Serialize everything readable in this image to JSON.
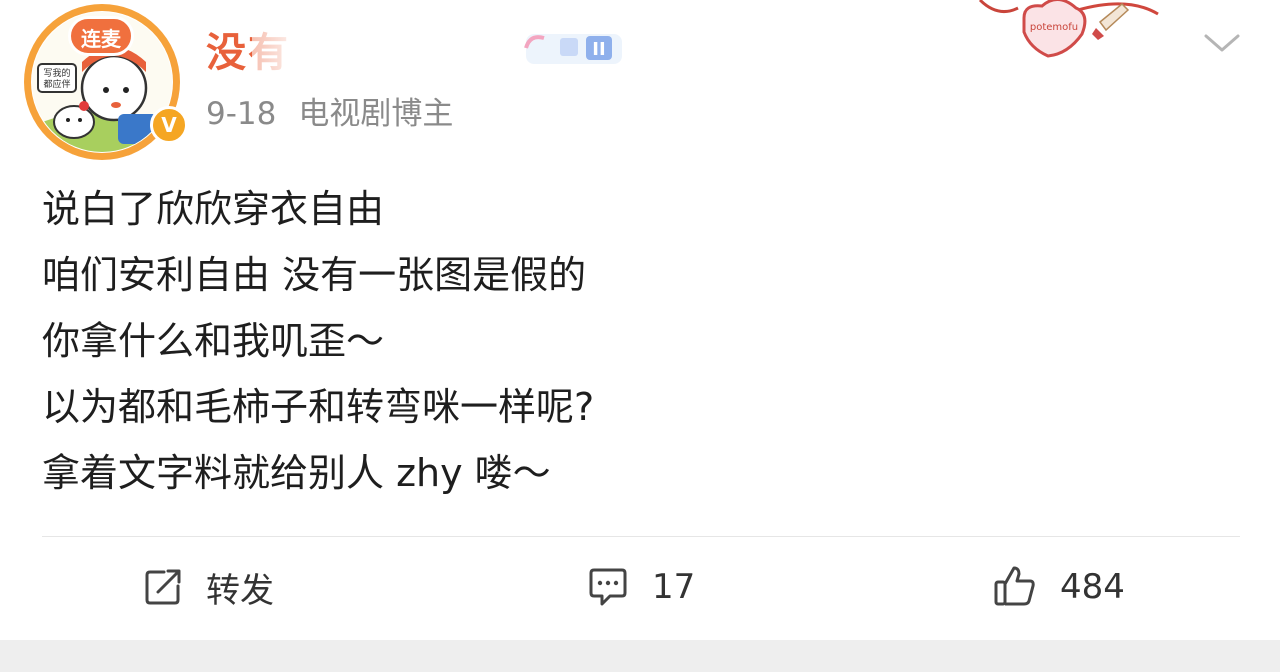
{
  "post": {
    "username": "没有",
    "time": "9-18",
    "role": "电视剧博主",
    "avatar_badge": "连麦",
    "avatar_sign": "写我的都应伴",
    "deco_text": "potemofu",
    "vip_label": "II",
    "content_lines": [
      "说白了欣欣穿衣自由",
      "咱们安利自由 没有一张图是假的",
      "你拿什么和我叽歪～",
      "以为都和毛柿子和转弯咪一样呢?",
      "拿着文字料就给别人 zhy 喽～"
    ]
  },
  "actions": {
    "repost_label": "转发",
    "comment_count": "17",
    "like_count": "484"
  },
  "icons": {
    "repost": "edit-share-icon",
    "comment": "comment-bubble-icon",
    "like": "thumbs-up-icon",
    "more": "chevron-down-icon"
  },
  "colors": {
    "username": "#e8613b",
    "meta": "#8a8a8a",
    "verified": "#f5a623",
    "badge": "#f0703e"
  }
}
